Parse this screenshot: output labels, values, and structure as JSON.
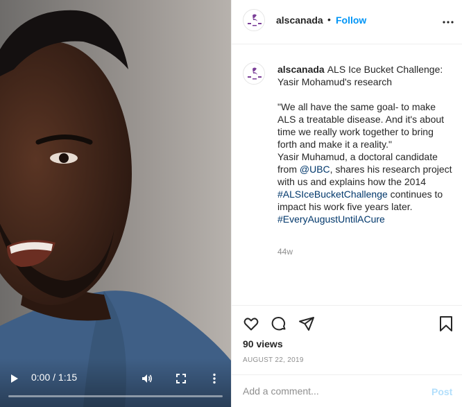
{
  "video": {
    "time_display": "0:00 / 1:15",
    "progress": 0,
    "icons": {
      "play": "play-icon",
      "volume": "volume-icon",
      "fullscreen": "fullscreen-icon",
      "more": "more-vertical-icon"
    }
  },
  "header": {
    "username": "alscanada",
    "separator": "•",
    "follow_label": "Follow",
    "more_icon": "more-horizontal-icon"
  },
  "post": {
    "username": "alscanada",
    "title": "ALS Ice Bucket Challenge: Yasir Mohamud's research",
    "quote": "\"We all have the same goal- to make ALS a treatable disease. And it's about time we really work together to bring forth and make it a reality.\"",
    "body_1": "Yasir Muhamud, a doctoral candidate from",
    "mention": "@UBC",
    "body_2": ", shares his research project with us and explains how the 2014",
    "hashtag_1": "#ALSIceBucketChallenge",
    "body_3": "continues to impact his work five years later.",
    "hashtag_2": "#EveryAugustUntilACure",
    "time_ago": "44w"
  },
  "actions": {
    "like_icon": "heart-icon",
    "comment_icon": "comment-icon",
    "share_icon": "share-icon",
    "save_icon": "bookmark-icon",
    "views": "90 views",
    "date": "AUGUST 22, 2019"
  },
  "comment": {
    "placeholder": "Add a comment...",
    "post_label": "Post"
  },
  "colors": {
    "link_blue": "#0095f6",
    "hashtag_blue": "#00376b",
    "muted_gray": "#8e8e8e",
    "logo_purple": "#7b3f98"
  }
}
